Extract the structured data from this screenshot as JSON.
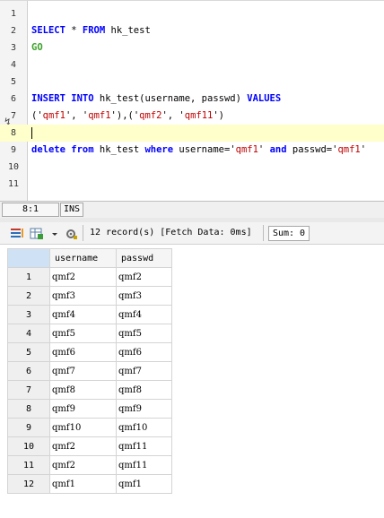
{
  "editor": {
    "lines": [
      {
        "num": "1",
        "tokens": []
      },
      {
        "num": "2",
        "tokens": [
          {
            "t": "SELECT",
            "c": "kw"
          },
          {
            "t": " * ",
            "c": ""
          },
          {
            "t": "FROM",
            "c": "kw"
          },
          {
            "t": " hk_test",
            "c": ""
          }
        ]
      },
      {
        "num": "3",
        "tokens": [
          {
            "t": "GO",
            "c": "kw-green"
          }
        ]
      },
      {
        "num": "4",
        "tokens": []
      },
      {
        "num": "5",
        "tokens": []
      },
      {
        "num": "6",
        "tokens": [
          {
            "t": "INSERT",
            "c": "kw"
          },
          {
            "t": " ",
            "c": ""
          },
          {
            "t": "INTO",
            "c": "kw"
          },
          {
            "t": " hk_test(username, passwd) ",
            "c": ""
          },
          {
            "t": "VALUES",
            "c": "kw"
          }
        ]
      },
      {
        "num": "7",
        "tokens": [
          {
            "t": "('",
            "c": ""
          },
          {
            "t": "qmf1",
            "c": "str"
          },
          {
            "t": "', '",
            "c": ""
          },
          {
            "t": "qmf1",
            "c": "str"
          },
          {
            "t": "'),('",
            "c": ""
          },
          {
            "t": "qmf2",
            "c": "str"
          },
          {
            "t": "', '",
            "c": ""
          },
          {
            "t": "qmf11",
            "c": "str"
          },
          {
            "t": "')",
            "c": ""
          }
        ]
      },
      {
        "num": "8",
        "tokens": [],
        "current": true
      },
      {
        "num": "9",
        "tokens": [
          {
            "t": "delete",
            "c": "kw"
          },
          {
            "t": " ",
            "c": ""
          },
          {
            "t": "from",
            "c": "kw"
          },
          {
            "t": " hk_test ",
            "c": ""
          },
          {
            "t": "where",
            "c": "kw"
          },
          {
            "t": " username='",
            "c": ""
          },
          {
            "t": "qmf1",
            "c": "str"
          },
          {
            "t": "' ",
            "c": ""
          },
          {
            "t": "and",
            "c": "kw"
          },
          {
            "t": " passwd='",
            "c": ""
          },
          {
            "t": "qmf1",
            "c": "str"
          },
          {
            "t": "'",
            "c": ""
          }
        ]
      },
      {
        "num": "10",
        "tokens": []
      },
      {
        "num": "11",
        "tokens": []
      }
    ]
  },
  "status": {
    "position": "8:1",
    "mode": "INS"
  },
  "results": {
    "record_info": "12 record(s) [Fetch Data: 0ms]",
    "sum": "Sum: 0",
    "columns": [
      "username",
      "passwd"
    ],
    "rows": [
      [
        "1",
        "qmf2",
        "qmf2"
      ],
      [
        "2",
        "qmf3",
        "qmf3"
      ],
      [
        "3",
        "qmf4",
        "qmf4"
      ],
      [
        "4",
        "qmf5",
        "qmf5"
      ],
      [
        "5",
        "qmf6",
        "qmf6"
      ],
      [
        "6",
        "qmf7",
        "qmf7"
      ],
      [
        "7",
        "qmf8",
        "qmf8"
      ],
      [
        "8",
        "qmf9",
        "qmf9"
      ],
      [
        "9",
        "qmf10",
        "qmf10"
      ],
      [
        "10",
        "qmf2",
        "qmf11"
      ],
      [
        "11",
        "qmf2",
        "qmf11"
      ],
      [
        "12",
        "qmf1",
        "qmf1"
      ]
    ]
  },
  "toolbar_icons": [
    "grid-view-icon",
    "export-icon",
    "dropdown-arrow-icon",
    "settings-icon"
  ]
}
